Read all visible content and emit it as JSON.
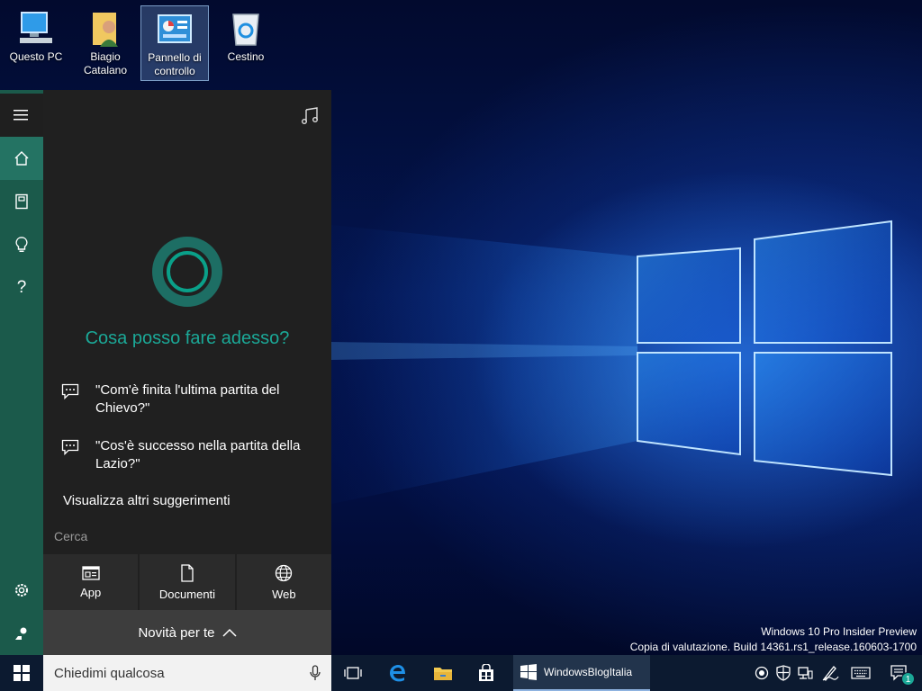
{
  "desktop": {
    "icons": [
      {
        "label_line1": "Questo PC",
        "label_line2": ""
      },
      {
        "label_line1": "Biagio",
        "label_line2": "Catalano"
      },
      {
        "label_line1": "Pannello di",
        "label_line2": "controllo"
      },
      {
        "label_line1": "Cestino",
        "label_line2": ""
      }
    ],
    "selected_icon": "Pannello di controllo"
  },
  "cortana": {
    "greeting": "Cosa posso fare adesso?",
    "suggestions": [
      {
        "text": "\"Com'è finita l'ultima partita del Chievo?\""
      },
      {
        "text": "\"Cos'è successo nella partita della Lazio?\""
      }
    ],
    "more_suggestions": "Visualizza altri suggerimenti",
    "search_section": "Cerca",
    "filters": [
      {
        "label": "App",
        "icon": "app-icon"
      },
      {
        "label": "Documenti",
        "icon": "document-icon"
      },
      {
        "label": "Web",
        "icon": "globe-icon"
      }
    ],
    "news_bar": "Novità per te",
    "rail_icons": [
      "hamburger-menu-icon",
      "home-icon",
      "notebook-icon",
      "lightbulb-icon",
      "help-icon",
      "settings-icon",
      "feedback-icon"
    ],
    "accent_color": "#1ba897",
    "rail_color": "#1b5a4b"
  },
  "watermark": {
    "line1": "Windows 10 Pro Insider Preview",
    "line2": "Copia di valutazione. Build 14361.rs1_release.160603-1700"
  },
  "taskbar": {
    "search_placeholder": "Chiedimi qualcosa",
    "open_app": "WindowsBlogItalia",
    "notification_count": "1",
    "pinned": [
      "task-view-icon",
      "edge-icon",
      "file-explorer-icon",
      "store-icon"
    ]
  }
}
